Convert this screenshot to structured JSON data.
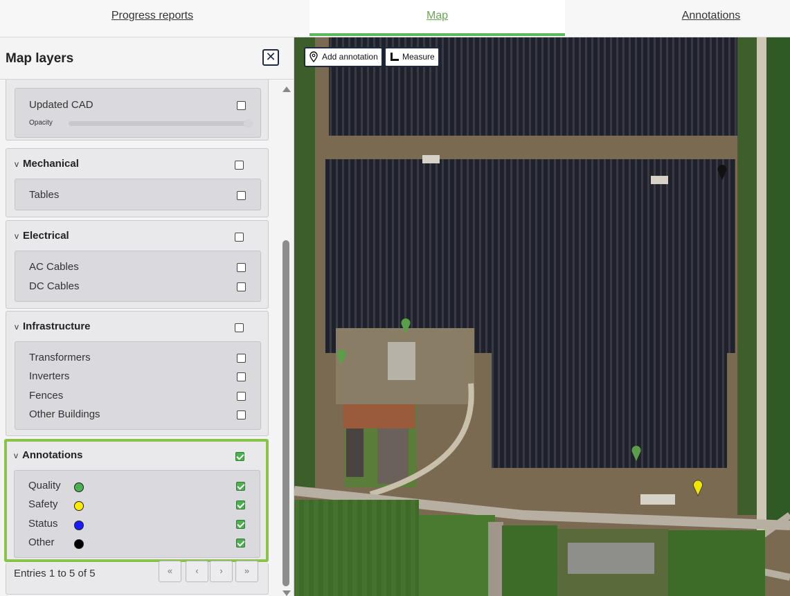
{
  "tabs": [
    {
      "label": "Progress reports"
    },
    {
      "label": "Map"
    },
    {
      "label": "Annotations"
    }
  ],
  "panel": {
    "title": "Map layers",
    "close_label": "✕"
  },
  "cad": {
    "label": "Updated CAD",
    "opacity_label": "Opacity",
    "opacity_value": 1.0,
    "checked": false
  },
  "groups": {
    "mechanical": {
      "title": "Mechanical",
      "items": [
        "Tables"
      ]
    },
    "electrical": {
      "title": "Electrical",
      "items": [
        "AC Cables",
        "DC Cables"
      ]
    },
    "infrastructure": {
      "title": "Infrastructure",
      "items": [
        "Transformers",
        "Inverters",
        "Fences",
        "Other Buildings"
      ]
    },
    "annotations": {
      "title": "Annotations",
      "checked": true,
      "items": [
        {
          "label": "Quality",
          "color": "#4caf50",
          "checked": true
        },
        {
          "label": "Safety",
          "color": "#ffeb00",
          "checked": true
        },
        {
          "label": "Status",
          "color": "#1a1aff",
          "checked": true
        },
        {
          "label": "Other",
          "color": "#000000",
          "checked": true
        }
      ]
    }
  },
  "pager": {
    "text": "Entries 1 to 5 of 5",
    "first": "«",
    "prev": "‹",
    "next": "›",
    "last": "»"
  },
  "map": {
    "add_annotation_label": "Add annotation",
    "measure_label": "Measure",
    "markers": [
      {
        "type": "other",
        "color": "#111111"
      },
      {
        "type": "quality",
        "color": "#5a9e4a"
      },
      {
        "type": "quality",
        "color": "#5a9e4a"
      },
      {
        "type": "quality",
        "color": "#5a9e4a"
      },
      {
        "type": "safety",
        "color": "#f2e600"
      }
    ]
  },
  "colors": {
    "accent": "#5cb85c",
    "highlight": "#8bc34a",
    "dark": "#1e2a44"
  }
}
